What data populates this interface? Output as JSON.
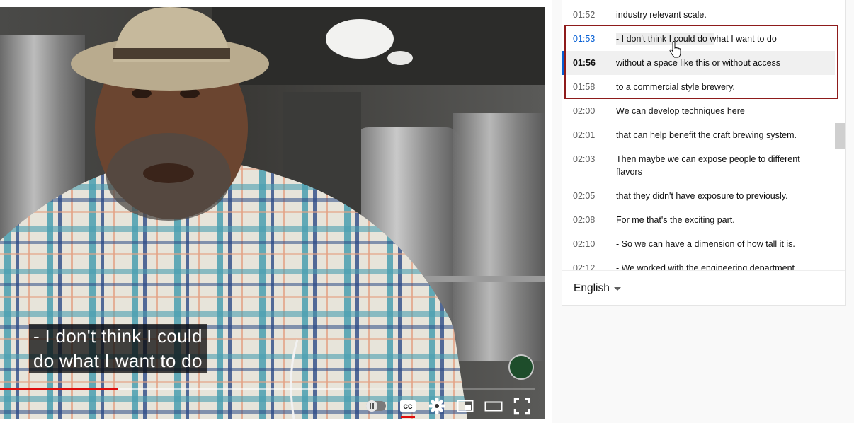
{
  "video": {
    "caption_lines": [
      "- I don't think I could",
      "do what I want to do"
    ],
    "progress": {
      "played_fraction": 0.221,
      "buffered_fraction": 0.64
    },
    "controls": {
      "autoplay_icon": "pause-icon",
      "cc_icon": "cc-icon",
      "settings_icon": "gear-icon",
      "miniplayer_icon": "miniplayer-icon",
      "theater_icon": "theater-mode-icon",
      "fullscreen_icon": "fullscreen-icon"
    },
    "cc_label": "CC"
  },
  "transcript": {
    "segments": [
      {
        "time": "01:52",
        "text": "industry relevant scale."
      },
      {
        "time": "01:53",
        "text": "- I don't think I could do what I want to do",
        "state": "hover"
      },
      {
        "time": "01:56",
        "text": "without a space like this or without access",
        "state": "active"
      },
      {
        "time": "01:58",
        "text": "to a commercial style brewery."
      },
      {
        "time": "02:00",
        "text": "We can develop techniques here"
      },
      {
        "time": "02:01",
        "text": "that can help benefit the craft brewing system."
      },
      {
        "time": "02:03",
        "text": "Then maybe we can expose people to different flavors"
      },
      {
        "time": "02:05",
        "text": "that they didn't have exposure to previously."
      },
      {
        "time": "02:08",
        "text": "For me that's the exciting part."
      },
      {
        "time": "02:10",
        "text": "- So we can have a dimension of how tall it is."
      },
      {
        "time": "02:12",
        "text": "- We worked with the engineering department"
      }
    ],
    "language": "English"
  },
  "colors": {
    "accent": "#065fd4",
    "progress": "#e00d0d",
    "highlight_border": "#8e1b1b"
  }
}
